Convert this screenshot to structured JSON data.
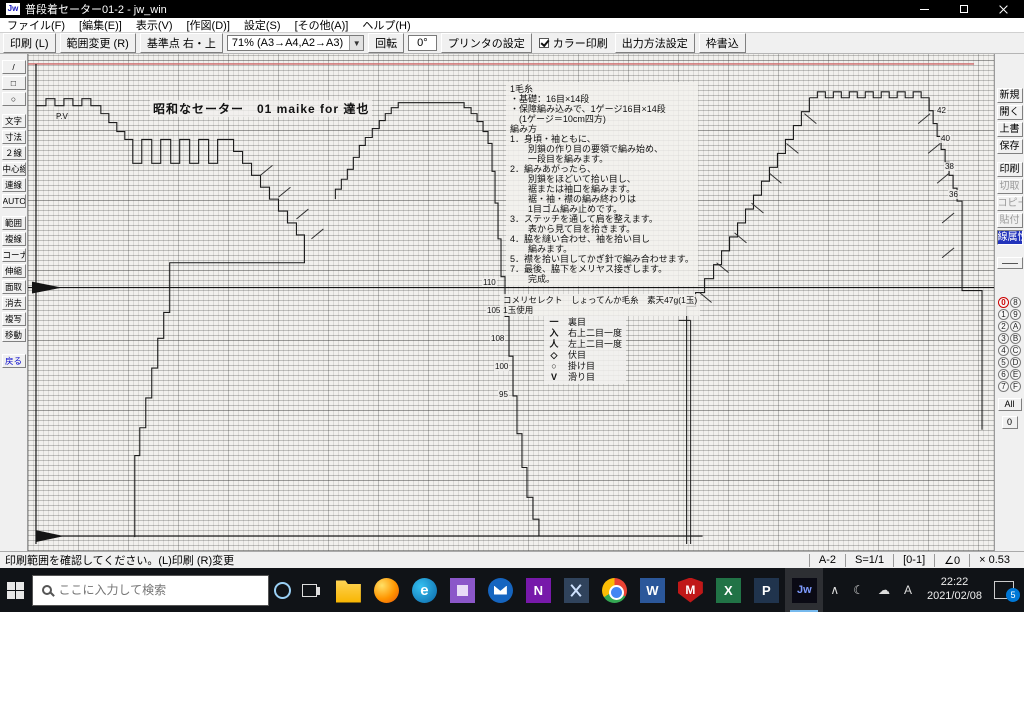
{
  "colors": {
    "accent": "#0078d7",
    "red_line": "#cc6666",
    "selected_btn": "#2233bb"
  },
  "window": {
    "title": "普段着セーター01-2 - jw_win",
    "icon_text": "Jw"
  },
  "menu_bar": {
    "items": [
      "ファイル(F)",
      "[編集(E)]",
      "表示(V)",
      "[作図(D)]",
      "設定(S)",
      "[その他(A)]",
      "ヘルプ(H)"
    ]
  },
  "toolbar": {
    "print": "印刷 (L)",
    "range_change": "範囲変更 (R)",
    "base_point": "基準点  右・上",
    "zoom_select": "71% (A3→A4,A2→A3)",
    "rotate": "回転",
    "rotate_value": "0°",
    "printer_setup": "プリンタの設定",
    "color_print": "カラー印刷",
    "output_method": "出力方法設定",
    "frame_write": "枠書込"
  },
  "left_toolbar": {
    "line_icon": "/",
    "rect_icon": "□",
    "circle_icon": "○",
    "items": [
      "文字",
      "寸法",
      "２線",
      "中心線",
      "連線",
      "AUTO",
      "範囲",
      "複線",
      "コーナー",
      "伸縮",
      "面取",
      "消去",
      "複写",
      "移動"
    ],
    "back": "戻る"
  },
  "right_toolbar": {
    "items": [
      {
        "label": "新規"
      },
      {
        "label": "開く"
      },
      {
        "label": "上書"
      },
      {
        "label": "保存"
      },
      {
        "label": "印刷"
      },
      {
        "label": "切取"
      },
      {
        "label": "コピー"
      },
      {
        "label": "貼付"
      },
      {
        "label": "線属性"
      }
    ],
    "layers_left": [
      "0",
      "1",
      "2",
      "3",
      "4",
      "5",
      "6",
      "7"
    ],
    "layers_right": [
      "8",
      "9",
      "A",
      "B",
      "C",
      "D",
      "E",
      "F"
    ],
    "all_button": "All",
    "zero_button": "0"
  },
  "canvas": {
    "chart_title": "昭和なセーター　01 maike for 達也",
    "pv_label": "P.V",
    "instructions": "1毛糸\n・基礎：16目×14段\n・保障編み込みで、1ゲージ16目×14段\n　(1ゲージ＝10cm四方)\n編み方\n1．身頃・袖ともに、\n　　別鎖の作り目の要領で編み始め、\n　　一段目を編みます。\n2．編みあがったら、\n　　別鎖をほどいて拾い目し、\n　　裾または袖口を編みます。\n　　裾・袖・襟の編み終わりは\n　　1目ゴム編み止めです。\n3．ステッチを通して肩を整えます。\n　　表から見て目を拾きます。\n4．脇を縫い合わせ、袖を拾い目し\n　　編みます。\n5．襟を拾い目してかぎ針で編み合わせます。\n7．最後、脇下をメリヤス接ぎします。\n　　完成。",
    "yarn_note": "コメリセレクト　しょってんか毛糸　素天47g(1玉)\n1玉使用",
    "legend": [
      {
        "sym": "一",
        "label": "裏目"
      },
      {
        "sym": "入",
        "label": "右上二目一度"
      },
      {
        "sym": "人",
        "label": "左上二目一度"
      },
      {
        "sym": "◇",
        "label": "伏目"
      },
      {
        "sym": "○",
        "label": "掛け目"
      },
      {
        "sym": "V",
        "label": "滑り目"
      }
    ],
    "row_counts": [
      "110",
      "105",
      "108",
      "100",
      "95"
    ],
    "sleeve_counts": [
      "42",
      "40",
      "38",
      "36"
    ]
  },
  "status_bar": {
    "message": "印刷範囲を確認してください。(L)印刷 (R)変更",
    "cell": "A-2",
    "scale": "S=1/1",
    "range": "[0-1]",
    "angle": "∠0",
    "ratio": "× 0.53"
  },
  "taskbar": {
    "search_placeholder": "ここに入力して検索",
    "time": "22:22",
    "date": "2021/02/08",
    "ime": "A",
    "badge": "5",
    "chevron": "∧",
    "cloud": "☁",
    "moon": "☾",
    "icons": [
      {
        "name": "explorer",
        "glyph": ""
      },
      {
        "name": "firefox",
        "glyph": ""
      },
      {
        "name": "edge",
        "glyph": "e"
      },
      {
        "name": "photos",
        "glyph": ""
      },
      {
        "name": "mail",
        "glyph": ""
      },
      {
        "name": "onenote",
        "glyph": "N"
      },
      {
        "name": "snip",
        "glyph": ""
      },
      {
        "name": "chrome",
        "glyph": ""
      },
      {
        "name": "word",
        "glyph": "W"
      },
      {
        "name": "mcafee",
        "glyph": "M"
      },
      {
        "name": "excel",
        "glyph": "X"
      },
      {
        "name": "powerpoint",
        "glyph": "P"
      },
      {
        "name": "jw",
        "glyph": "Jw"
      }
    ]
  }
}
